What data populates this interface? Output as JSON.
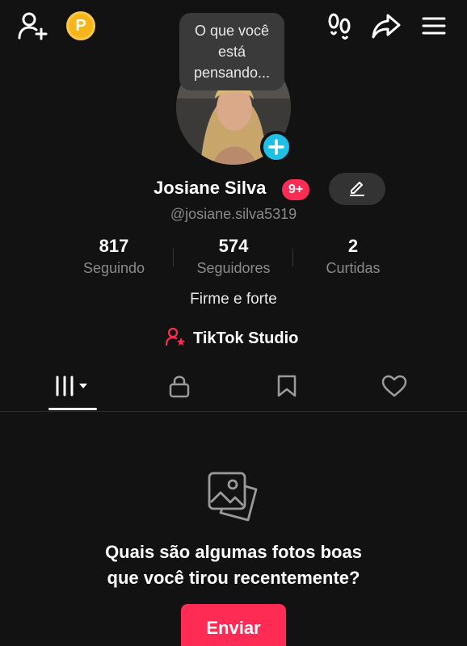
{
  "header": {
    "icons": [
      "add-friend-icon",
      "coin-icon",
      "footprints-icon",
      "share-icon",
      "menu-icon"
    ],
    "coin_letter": "P"
  },
  "profile": {
    "status_bubble": "O que você está pensando...",
    "name": "Josiane Silva",
    "notification_badge": "9+",
    "handle": "@josiane.silva5319",
    "bio": "Firme e forte"
  },
  "stats": [
    {
      "value": "817",
      "label": "Seguindo"
    },
    {
      "value": "574",
      "label": "Seguidores"
    },
    {
      "value": "2",
      "label": "Curtidas"
    }
  ],
  "studio": {
    "label": "TikTok Studio"
  },
  "tabs": [
    "videos-grid-icon",
    "lock-icon",
    "bookmark-icon",
    "heart-icon"
  ],
  "empty_state": {
    "title_line1": "Quais são algumas fotos boas",
    "title_line2": "que você tirou recentemente?",
    "button": "Enviar"
  },
  "colors": {
    "accent": "#fe2c55",
    "plus": "#20bfe6",
    "coin": "#f6b51b",
    "background": "#121212"
  }
}
